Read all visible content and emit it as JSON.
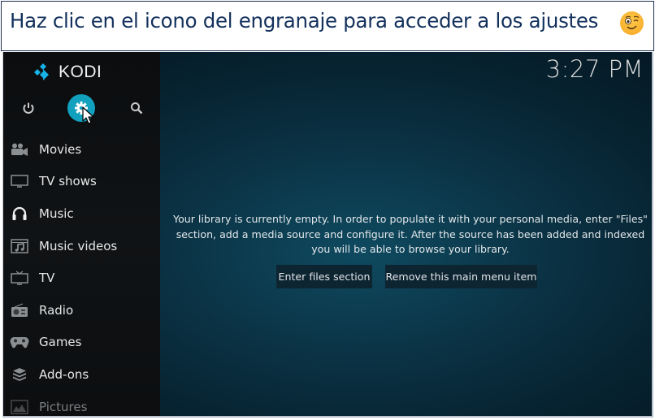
{
  "banner": {
    "title": "Haz clic en el icono del engranaje para acceder a los ajustes",
    "emoji": "winking-face-emoji"
  },
  "app": {
    "logo_text": "KODI",
    "clock": "3:27 PM",
    "top_buttons": [
      {
        "name": "power",
        "icon": "power-icon"
      },
      {
        "name": "settings",
        "icon": "gear-icon",
        "highlighted": true
      },
      {
        "name": "search",
        "icon": "search-icon"
      }
    ],
    "menu": [
      {
        "label": "Movies",
        "icon": "movie-camera-icon"
      },
      {
        "label": "TV shows",
        "icon": "monitor-icon"
      },
      {
        "label": "Music",
        "icon": "headphones-icon"
      },
      {
        "label": "Music videos",
        "icon": "music-video-icon"
      },
      {
        "label": "TV",
        "icon": "tv-icon"
      },
      {
        "label": "Radio",
        "icon": "radio-icon"
      },
      {
        "label": "Games",
        "icon": "gamepad-icon"
      },
      {
        "label": "Add-ons",
        "icon": "addons-box-icon"
      },
      {
        "label": "Pictures",
        "icon": "picture-icon"
      }
    ],
    "message": "Your library is currently empty. In order to populate it with your personal media, enter \"Files\" section, add a media source and configure it. After the source has been added and indexed you will be able to browse your library.",
    "buttons": {
      "enter_files": "Enter files section",
      "remove_item": "Remove this main menu item"
    },
    "colors": {
      "accent": "#12a0bf",
      "banner_text": "#13315c",
      "logo_blue": "#17b2e7"
    }
  }
}
